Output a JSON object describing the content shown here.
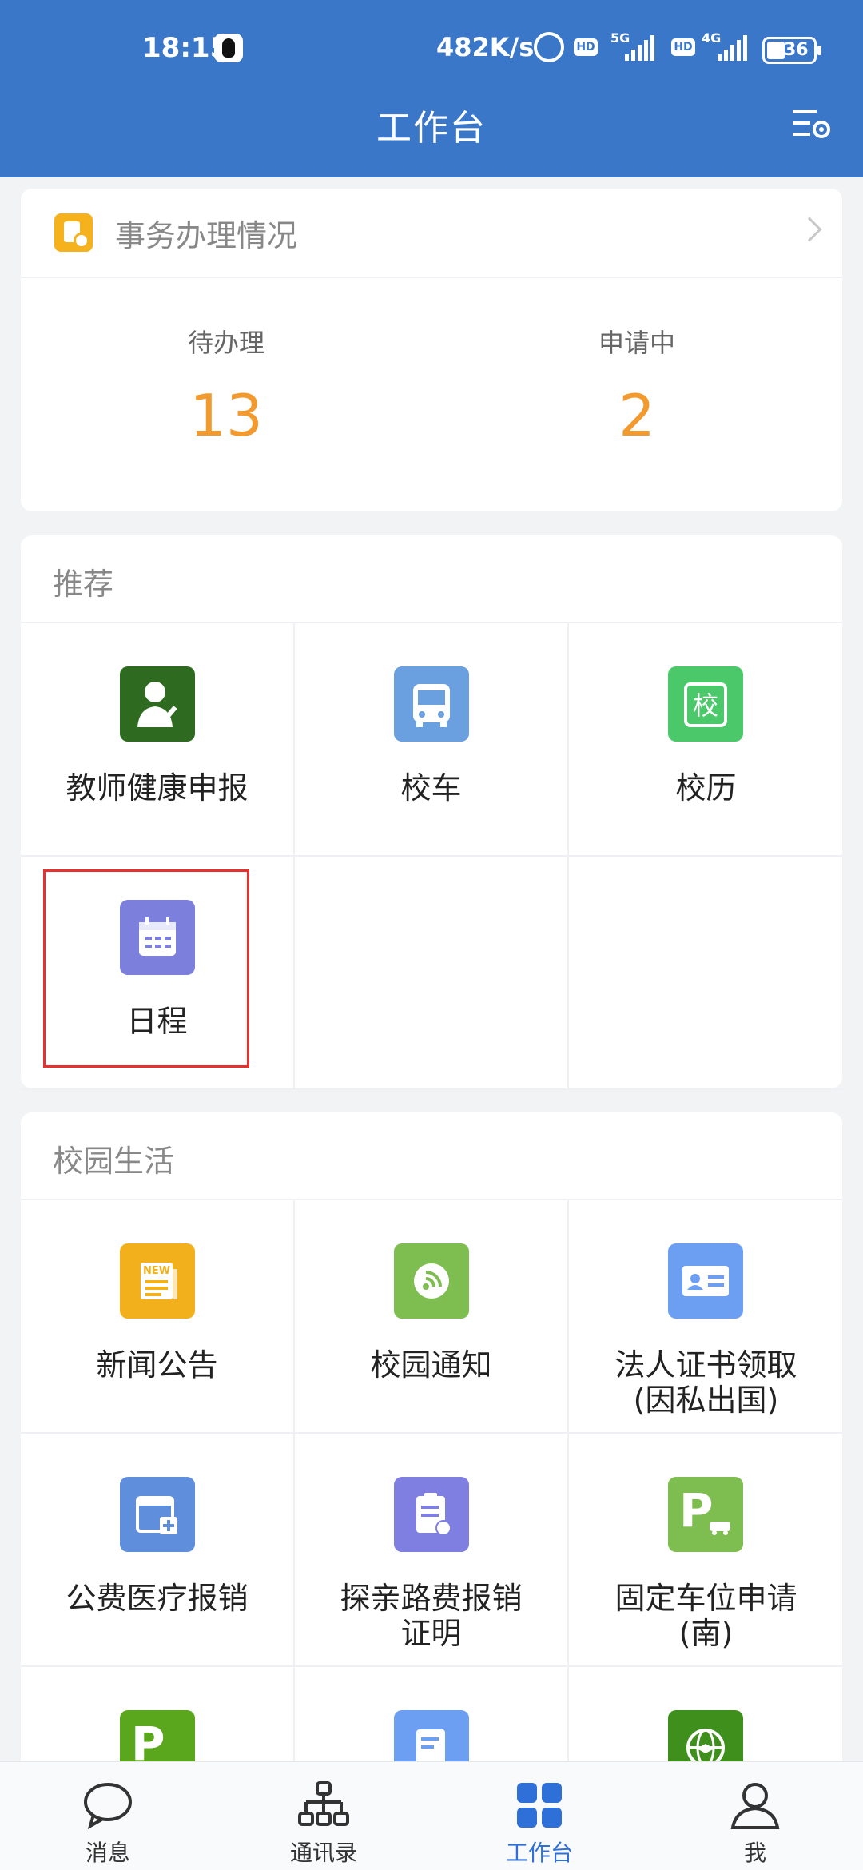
{
  "status_bar": {
    "time": "18:15",
    "net_speed": "482K/s",
    "sim1_network": "5G",
    "sim2_network": "4G",
    "hd_label": "HD",
    "battery": "36"
  },
  "header": {
    "title": "工作台"
  },
  "affairs": {
    "title": "事务办理情况",
    "stats": [
      {
        "label": "待办理",
        "value": "13"
      },
      {
        "label": "申请中",
        "value": "2"
      }
    ]
  },
  "recommend": {
    "title": "推荐",
    "items": [
      {
        "label": "教师健康申报",
        "icon": "teacher-health-icon",
        "color": "#2e6a1f"
      },
      {
        "label": "校车",
        "icon": "bus-icon",
        "color": "#6a9fe0"
      },
      {
        "label": "校历",
        "icon": "school-calendar-icon",
        "color": "#4bc96a",
        "glyph": "校"
      },
      {
        "label": "日程",
        "icon": "schedule-calendar-icon",
        "color": "#7c80dc"
      }
    ]
  },
  "campus_life": {
    "title": "校园生活",
    "items": [
      {
        "label": "新闻公告",
        "icon": "news-icon",
        "color": "#f2b11c",
        "glyph": "NEW"
      },
      {
        "label": "校园通知",
        "icon": "notice-rss-icon",
        "color": "#7ebd4f"
      },
      {
        "label": "法人证书领取(因私出国)",
        "icon": "id-card-icon",
        "color": "#6c9ef2"
      },
      {
        "label": "公费医疗报销",
        "icon": "medical-calendar-icon",
        "color": "#5f8fdc"
      },
      {
        "label": "探亲路费报销证明",
        "icon": "reimburse-clipboard-icon",
        "color": "#7e7fe0"
      },
      {
        "label": "固定车位申请(南)",
        "icon": "parking-icon",
        "color": "#7ebd4f",
        "glyph": "P"
      },
      {
        "label": "",
        "icon": "parking-temp-icon",
        "color": "#5aa61c",
        "glyph": "P"
      },
      {
        "label": "",
        "icon": "document-icon",
        "color": "#6c9ef2"
      },
      {
        "label": "",
        "icon": "globe-graduation-icon",
        "color": "#3f8f1c"
      }
    ]
  },
  "bottom_nav": {
    "items": [
      {
        "label": "消息",
        "icon": "message-bubble-icon"
      },
      {
        "label": "通讯录",
        "icon": "org-chart-icon"
      },
      {
        "label": "工作台",
        "icon": "grid-icon",
        "active": true
      },
      {
        "label": "我",
        "icon": "person-icon"
      }
    ]
  },
  "colors": {
    "header_bg": "#3a77c9",
    "accent_number": "#f29a2e",
    "nav_active": "#2f6fd8",
    "highlight_box": "#e8312f"
  }
}
